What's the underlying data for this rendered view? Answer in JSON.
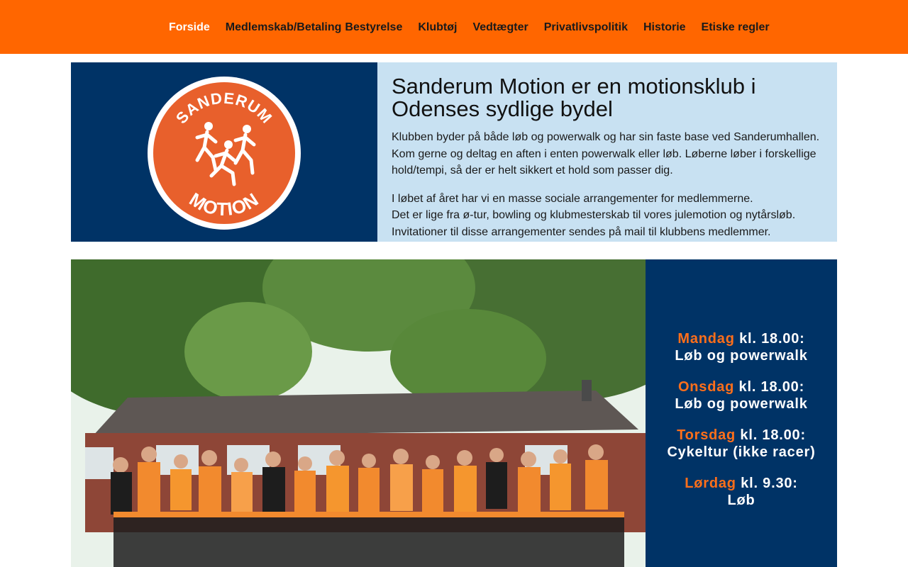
{
  "nav": {
    "items": [
      {
        "label": "Forside",
        "active": true
      },
      {
        "label": "Medlemskab/Betaling",
        "active": false
      },
      {
        "label": "Bestyrelse",
        "active": false
      },
      {
        "label": "Klubtøj",
        "active": false
      },
      {
        "label": "Vedtægter",
        "active": false
      },
      {
        "label": "Privatlivspolitik",
        "active": false
      },
      {
        "label": "Historie",
        "active": false
      },
      {
        "label": "Etiske regler",
        "active": false
      }
    ]
  },
  "logo": {
    "top_text": "SANDERUM",
    "bottom_text": "MOTION",
    "icon": "running-people-icon"
  },
  "intro": {
    "title_line1": "Sanderum Motion er en motionsklub i",
    "title_line2": "Odenses sydlige bydel",
    "p1_line1": "Klubben byder på både løb og powerwalk og har sin faste base ved Sanderumhallen.",
    "p1_line2": "Kom gerne og deltag en aften i enten powerwalk eller løb. Løberne løber i forskellige",
    "p1_line3": "hold/tempi, så der er helt sikkert et hold som passer dig.",
    "p2_line1": "I løbet af året har vi en masse sociale arrangementer for medlemmerne.",
    "p2_line2": "Det er lige fra ø-tur, bowling og klubmesterskab til vores julemotion og nytårsløb.",
    "p2_line3": "Invitationer til disse arrangementer sendes på mail til klubbens medlemmer."
  },
  "schedule": [
    {
      "day": "Mandag",
      "time": " kl. 18.00:",
      "activity": "Løb og powerwalk"
    },
    {
      "day": "Onsdag",
      "time": " kl. 18.00:",
      "activity": "Løb og powerwalk"
    },
    {
      "day": "Torsdag",
      "time": " kl. 18.00:",
      "activity": "Cykeltur (ikke racer)"
    },
    {
      "day": "Lørdag",
      "time": " kl. 9.30:",
      "activity": "Løb"
    }
  ],
  "colors": {
    "nav_bg": "#ff6600",
    "navy": "#003366",
    "light_blue": "#c8e1f2",
    "logo_orange": "#e8602c",
    "day_orange": "#ff6f1a"
  }
}
